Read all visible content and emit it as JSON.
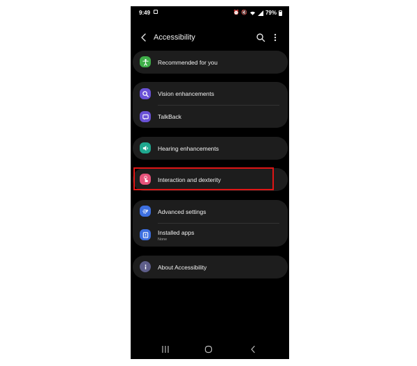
{
  "status_bar": {
    "time": "9:49",
    "battery": "79%",
    "icons": [
      "image-icon",
      "alarm-icon",
      "mute-icon",
      "wifi-icon",
      "signal-icon",
      "battery-icon"
    ]
  },
  "header": {
    "title": "Accessibility",
    "icons": [
      "back-icon",
      "search-icon",
      "more-options-icon"
    ]
  },
  "groups": [
    {
      "items": [
        {
          "label": "Recommended for you",
          "icon": "accessibility-person-icon",
          "icon_color": "#3fae49"
        }
      ]
    },
    {
      "items": [
        {
          "label": "Vision enhancements",
          "icon": "magnifier-icon",
          "icon_color": "#6a52d6"
        },
        {
          "label": "TalkBack",
          "icon": "chat-icon",
          "icon_color": "#6a52d6"
        }
      ]
    },
    {
      "items": [
        {
          "label": "Hearing enhancements",
          "icon": "speaker-icon",
          "icon_color": "#1fa88f"
        }
      ]
    },
    {
      "items": [
        {
          "label": "Interaction and dexterity",
          "icon": "hand-tap-icon",
          "icon_color": "#e5527a",
          "highlighted": true
        }
      ]
    },
    {
      "items": [
        {
          "label": "Advanced settings",
          "icon": "gear-plus-icon",
          "icon_color": "#3d6fe0"
        },
        {
          "label": "Installed apps",
          "sublabel": "None",
          "icon": "apps-icon",
          "icon_color": "#3d6fe0"
        }
      ]
    },
    {
      "items": [
        {
          "label": "About Accessibility",
          "icon": "info-icon",
          "icon_color": "#5e5e8a"
        }
      ]
    }
  ],
  "highlight_color": "#e01515",
  "nav_bar": {
    "icons": [
      "recents-icon",
      "home-icon",
      "back-nav-icon"
    ]
  }
}
